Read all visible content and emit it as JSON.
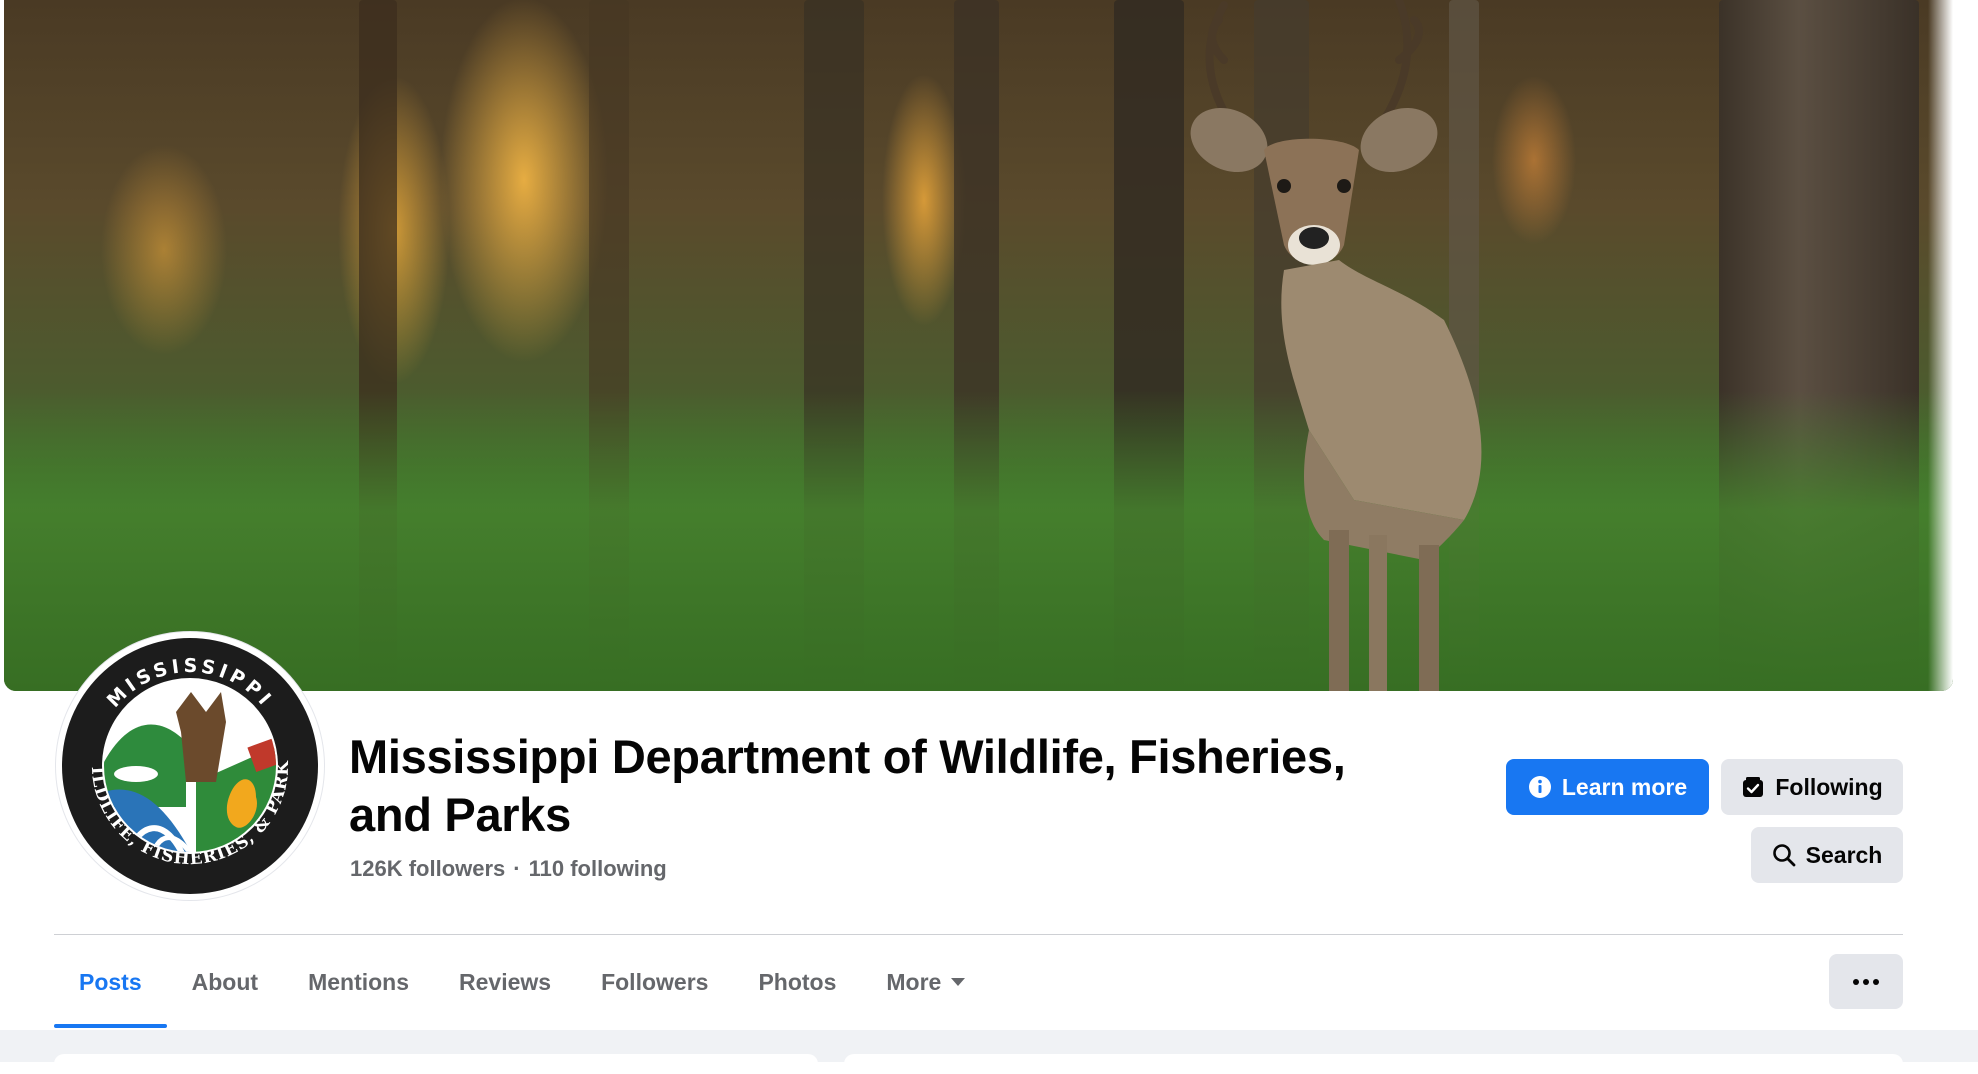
{
  "page": {
    "title": "Mississippi Department of Wildlife, Fisheries, and Parks",
    "followers": "126K followers",
    "separator": "·",
    "following_count": "110 following"
  },
  "cover_photo": {
    "icon": "cover-photo"
  },
  "avatar": {
    "top_text": "MISSISSIPPI",
    "bottom_text": "WILDLIFE, FISHERIES, & PARKS",
    "icon": "agency-logo"
  },
  "actions": {
    "learn_more": "Learn more",
    "following": "Following",
    "search": "Search"
  },
  "tabs": [
    {
      "label": "Posts",
      "active": true
    },
    {
      "label": "About"
    },
    {
      "label": "Mentions"
    },
    {
      "label": "Reviews"
    },
    {
      "label": "Followers"
    },
    {
      "label": "Photos"
    },
    {
      "label": "More",
      "dropdown": true
    }
  ],
  "colors": {
    "primary": "#1877f2",
    "secondary_bg": "#e4e6eb",
    "text_primary": "#050505",
    "text_secondary": "#65676b"
  }
}
